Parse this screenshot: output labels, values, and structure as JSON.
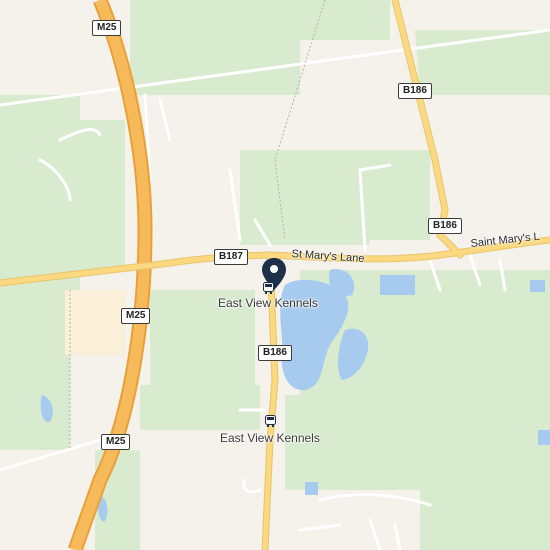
{
  "map": {
    "colors": {
      "background": "#f5f1eb",
      "park": "#d8ebcf",
      "motorway": "#f7ba5b",
      "motorway_casing": "#e8a13a",
      "major_road": "#fbd980",
      "minor_road": "#ffffff",
      "water": "#a6cbef",
      "marker": "#1e2f4a"
    },
    "road_shields": {
      "m25_top": "M25",
      "m25_mid": "M25",
      "m25_bottom": "M25",
      "b186_top": "B186",
      "b186_right": "B186",
      "b186_mid": "B186",
      "b187": "B187"
    },
    "road_labels": {
      "st_marys_lane": "St Mary's Lane",
      "saint_marys_lane_east": "Saint Mary's L"
    },
    "places": {
      "selected": "East View Kennels",
      "bus_stop": "East View Kennels"
    },
    "icons": {
      "marker": "map-pin-icon",
      "bus": "bus-stop-icon"
    }
  }
}
